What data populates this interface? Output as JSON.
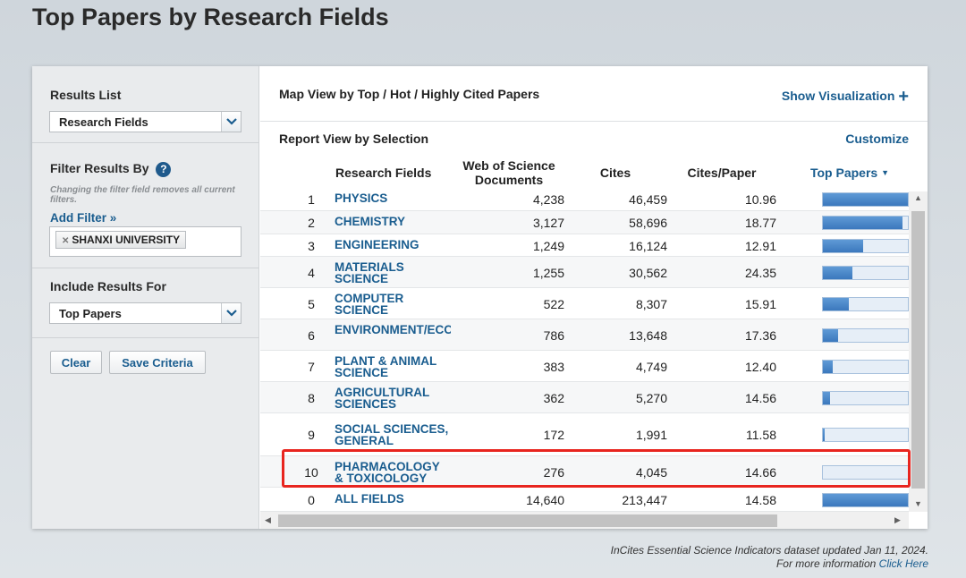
{
  "page_title": "Top Papers by Research Fields",
  "sidebar": {
    "results_list_label": "Results List",
    "results_list_value": "Research Fields",
    "filter_label": "Filter Results By",
    "help_glyph": "?",
    "filter_hint": "Changing the filter field removes all current filters.",
    "add_filter_label": "Add Filter »",
    "filter_chip": "SHANXI UNIVERSITY",
    "include_label": "Include Results For",
    "include_value": "Top Papers",
    "clear_label": "Clear",
    "save_label": "Save Criteria"
  },
  "main": {
    "map_view_title": "Map View by Top / Hot / Highly Cited Papers",
    "show_visualization": "Show Visualization",
    "report_view_title": "Report View by Selection",
    "customize_label": "Customize",
    "columns": {
      "field": "Research Fields",
      "docs": "Web of Science Documents",
      "cites": "Cites",
      "cites_per_paper": "Cites/Paper",
      "top_papers": "Top Papers"
    },
    "rows": [
      {
        "rank": "1",
        "field": "PHYSICS",
        "docs": "4,238",
        "cites": "46,459",
        "cpp": "10.96",
        "top_fraction": 1.0
      },
      {
        "rank": "2",
        "field": "CHEMISTRY",
        "docs": "3,127",
        "cites": "58,696",
        "cpp": "18.77",
        "top_fraction": 0.94
      },
      {
        "rank": "3",
        "field": "ENGINEERING",
        "docs": "1,249",
        "cites": "16,124",
        "cpp": "12.91",
        "top_fraction": 0.47
      },
      {
        "rank": "4",
        "field": "MATERIALS SCIENCE",
        "docs": "1,255",
        "cites": "30,562",
        "cpp": "24.35",
        "top_fraction": 0.35
      },
      {
        "rank": "5",
        "field": "COMPUTER SCIENCE",
        "docs": "522",
        "cites": "8,307",
        "cpp": "15.91",
        "top_fraction": 0.3
      },
      {
        "rank": "6",
        "field": "ENVIRONMENT/ECOLOGY",
        "docs": "786",
        "cites": "13,648",
        "cpp": "17.36",
        "top_fraction": 0.18
      },
      {
        "rank": "7",
        "field": "PLANT & ANIMAL SCIENCE",
        "docs": "383",
        "cites": "4,749",
        "cpp": "12.40",
        "top_fraction": 0.12
      },
      {
        "rank": "8",
        "field": "AGRICULTURAL SCIENCES",
        "docs": "362",
        "cites": "5,270",
        "cpp": "14.56",
        "top_fraction": 0.08
      },
      {
        "rank": "9",
        "field": "SOCIAL SCIENCES, GENERAL",
        "docs": "172",
        "cites": "1,991",
        "cpp": "11.58",
        "top_fraction": 0.02
      },
      {
        "rank": "10",
        "field": "PHARMACOLOGY & TOXICOLOGY",
        "docs": "276",
        "cites": "4,045",
        "cpp": "14.66",
        "top_fraction": 0.0
      },
      {
        "rank": "0",
        "field": "ALL FIELDS",
        "docs": "14,640",
        "cites": "213,447",
        "cpp": "14.58",
        "top_fraction": 1.0
      }
    ]
  },
  "footer": {
    "updated": "InCites Essential Science Indicators dataset updated Jan 11, 2024.",
    "more_info": "For more information",
    "click_here": "Click Here"
  },
  "colors": {
    "accent": "#1a5d8f",
    "highlight": "#e8251f",
    "bar": "#3b78bd"
  }
}
